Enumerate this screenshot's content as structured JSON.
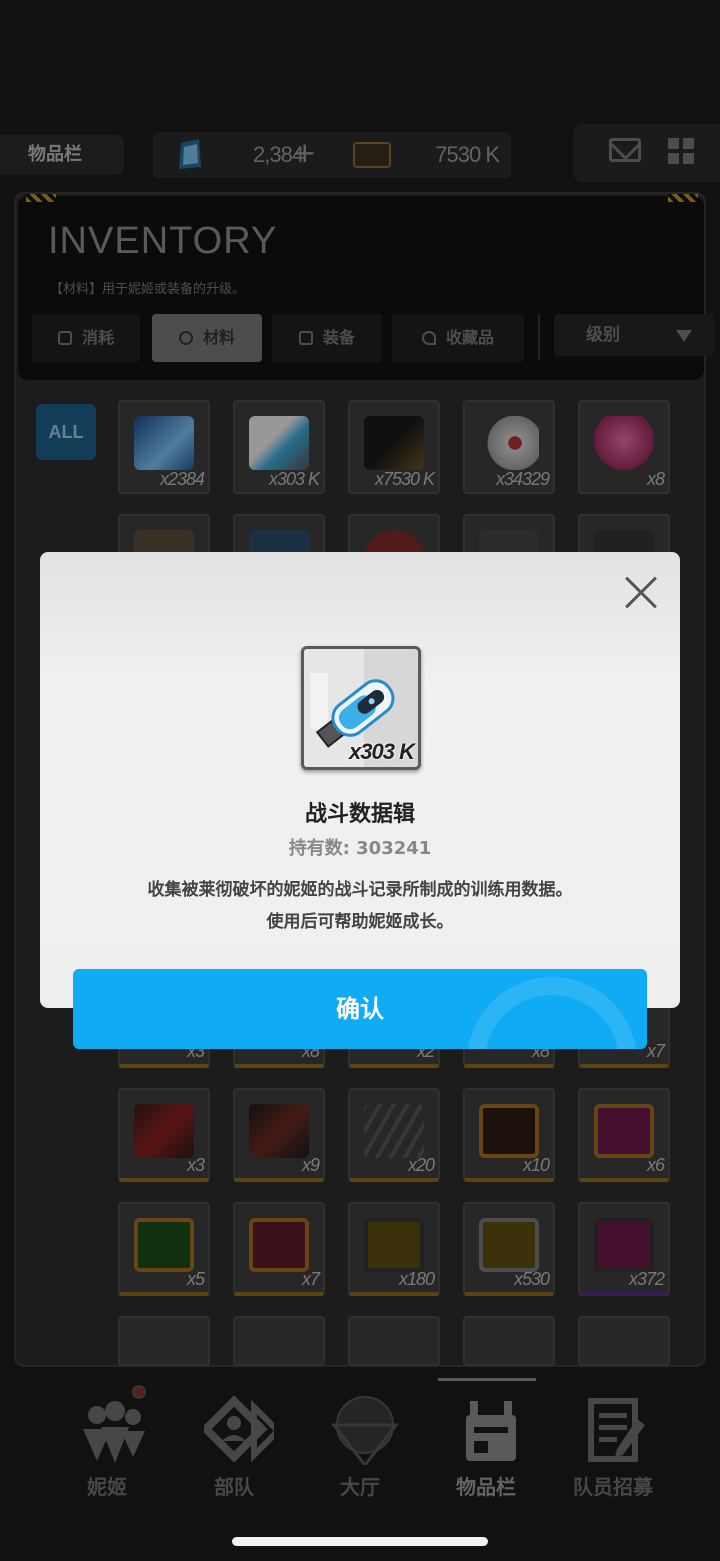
{
  "topbar": {
    "page_tag": "物品栏",
    "gems": "2,384",
    "plus": "+",
    "credits": "7530 K"
  },
  "inventory": {
    "title": "INVENTORY",
    "subtitle": "【材料】用于妮姬或装备的升级。",
    "tabs": [
      {
        "label": "消耗"
      },
      {
        "label": "材料"
      },
      {
        "label": "装备"
      },
      {
        "label": "收藏品"
      }
    ],
    "sort_label": "级别",
    "filter_all": "ALL",
    "row1": [
      "x2384",
      "x303 K",
      "x7530 K",
      "x34329",
      "x8"
    ],
    "row_hidden": [
      "x3",
      "x8",
      "x2",
      "x8",
      "x7"
    ],
    "row3": [
      "x3",
      "x9",
      "x20",
      "x10",
      "x6"
    ],
    "row4": [
      "x5",
      "x7",
      "x180",
      "x530",
      "x372"
    ]
  },
  "nav": {
    "items": [
      {
        "label": "妮姬"
      },
      {
        "label": "部队"
      },
      {
        "label": "大厅"
      },
      {
        "label": "物品栏"
      },
      {
        "label": "队员招募"
      }
    ]
  },
  "modal": {
    "item_qty": "x303 K",
    "item_name": "战斗数据辑",
    "count_text": "持有数: 303241",
    "desc_line1": "收集被莱彻破坏的妮姬的战斗记录所制成的训练用数据。",
    "desc_line2": "使用后可帮助妮姬成长。",
    "confirm": "确认"
  }
}
